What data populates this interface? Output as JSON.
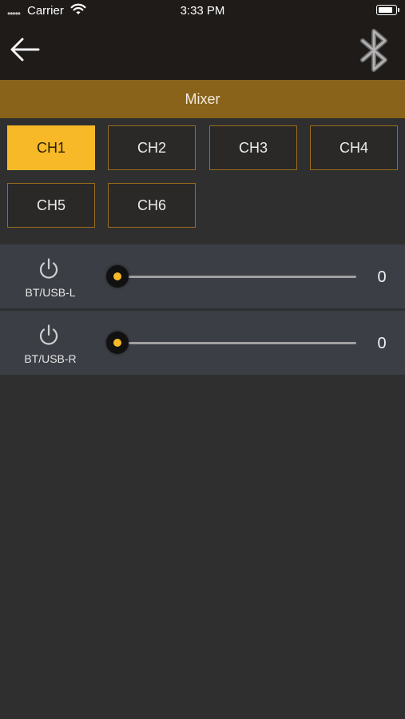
{
  "status_bar": {
    "carrier": "Carrier",
    "time": "3:33 PM"
  },
  "header": {
    "title": "Mixer"
  },
  "channels": [
    {
      "label": "CH1",
      "active": true
    },
    {
      "label": "CH2",
      "active": false
    },
    {
      "label": "CH3",
      "active": false
    },
    {
      "label": "CH4",
      "active": false
    },
    {
      "label": "CH5",
      "active": false
    },
    {
      "label": "CH6",
      "active": false
    }
  ],
  "faders": [
    {
      "label": "BT/USB-L",
      "value": "0",
      "level": 0
    },
    {
      "label": "BT/USB-R",
      "value": "0",
      "level": 0
    }
  ],
  "colors": {
    "accent": "#f7b928",
    "header_bar": "#8a631a",
    "background": "#2f2f2f"
  }
}
